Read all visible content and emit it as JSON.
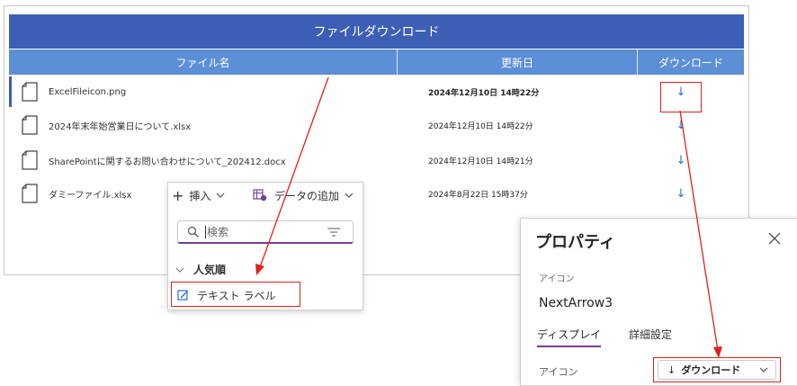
{
  "app": {
    "header_title": "ファイルダウンロード",
    "columns": [
      "ファイル名",
      "更新日",
      "ダウンロード"
    ],
    "rows": [
      {
        "name": "ExcelFileicon.png",
        "date": "2024年12月10日 14時22分"
      },
      {
        "name": "2024年末年始営業日について.xlsx",
        "date": "2024年12月10日 14時22分"
      },
      {
        "name": "SharePointに関するお問い合わせについて_202412.docx",
        "date": "2024年12月10日 14時21分"
      },
      {
        "name": "ダミーファイル.xlsx",
        "date": "2024年8月22日 15時37分"
      }
    ],
    "download_glyph": "↓"
  },
  "insert_panel": {
    "insert_label": "挿入",
    "add_data_label": "データの追加",
    "search_placeholder": "検索",
    "section_title": "人気順",
    "item_label": "テキスト ラベル"
  },
  "properties": {
    "title": "プロパティ",
    "control_type": "アイコン",
    "control_name": "NextArrow3",
    "tabs": [
      "ディスプレイ",
      "詳細設定"
    ],
    "icon_prop_label": "アイコン",
    "icon_value": "ダウンロード"
  },
  "colors": {
    "header": "#3c5fb5",
    "column_header": "#5c8fd6",
    "accent": "#7a3c96",
    "highlight": "#e0201b",
    "download_icon": "#2d6bd6"
  }
}
